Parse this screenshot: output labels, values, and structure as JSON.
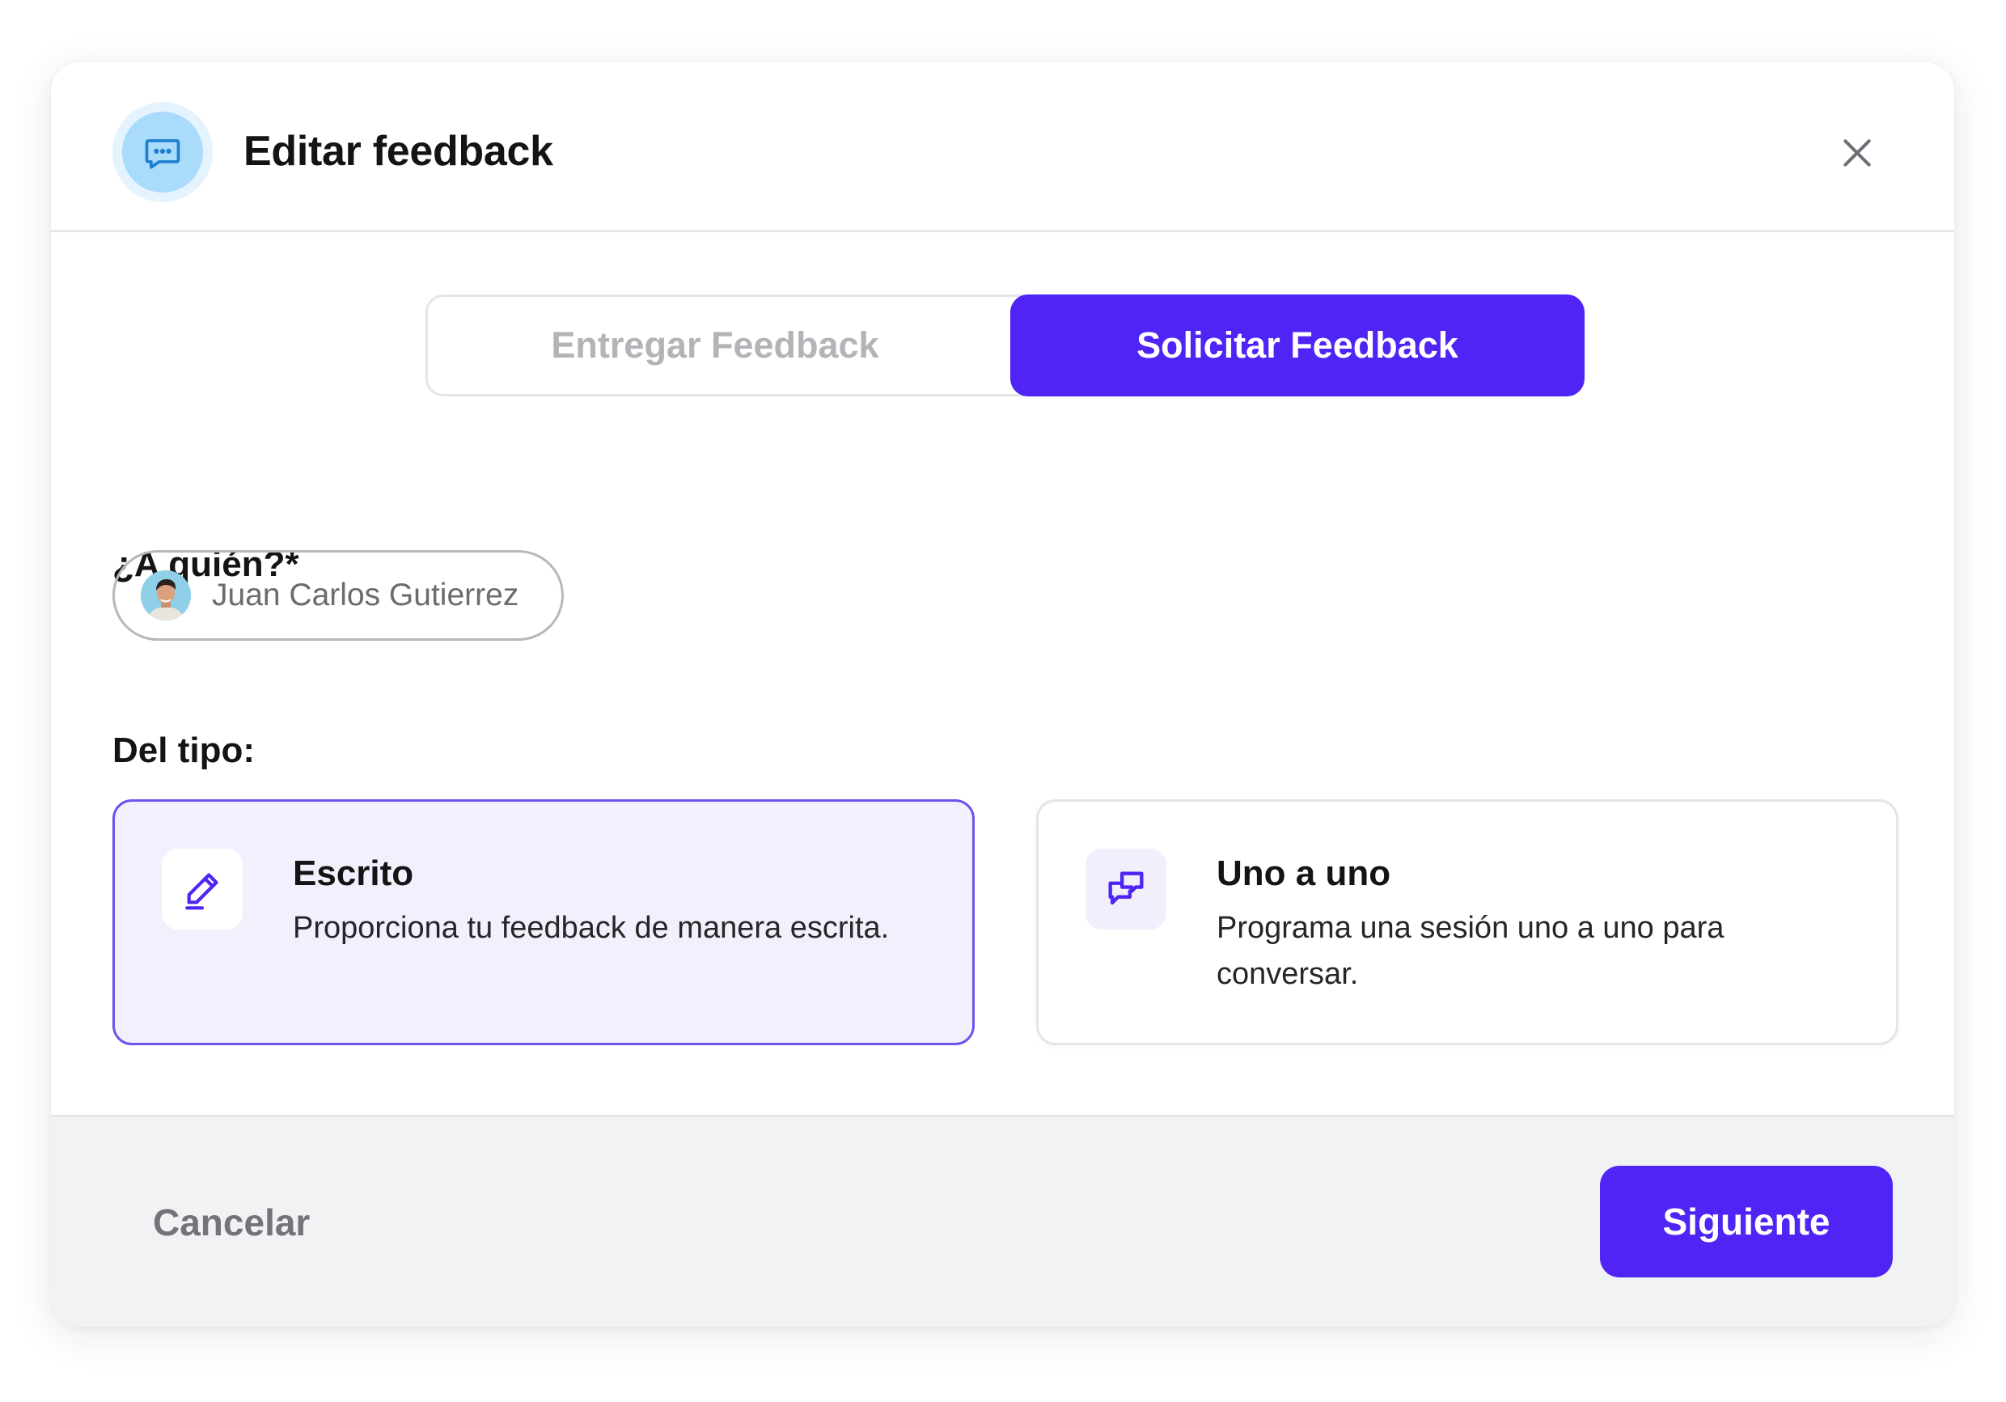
{
  "dialog": {
    "title": "Editar feedback",
    "icon": "chat-bubble-icon",
    "close_icon": "close-icon"
  },
  "tabs": [
    {
      "label": "Entregar Feedback",
      "selected": false
    },
    {
      "label": "Solicitar Feedback",
      "selected": true
    }
  ],
  "recipient": {
    "label": "¿A quién?*",
    "selected_name": "Juan Carlos Gutierrez"
  },
  "type": {
    "label": "Del tipo:",
    "options": [
      {
        "title": "Escrito",
        "description": "Proporciona tu feedback de manera escrita.",
        "icon": "pencil-icon",
        "selected": true
      },
      {
        "title": "Uno a uno",
        "description": "Programa una sesión uno a uno para conversar.",
        "icon": "conversation-icon",
        "selected": false
      }
    ]
  },
  "footer": {
    "cancel_label": "Cancelar",
    "next_label": "Siguiente"
  },
  "colors": {
    "accent": "#4f24f5",
    "selected_card_bg": "#f3f0fd",
    "selected_card_border": "#7150ed",
    "header_icon_bg": "#a9dcfb"
  }
}
